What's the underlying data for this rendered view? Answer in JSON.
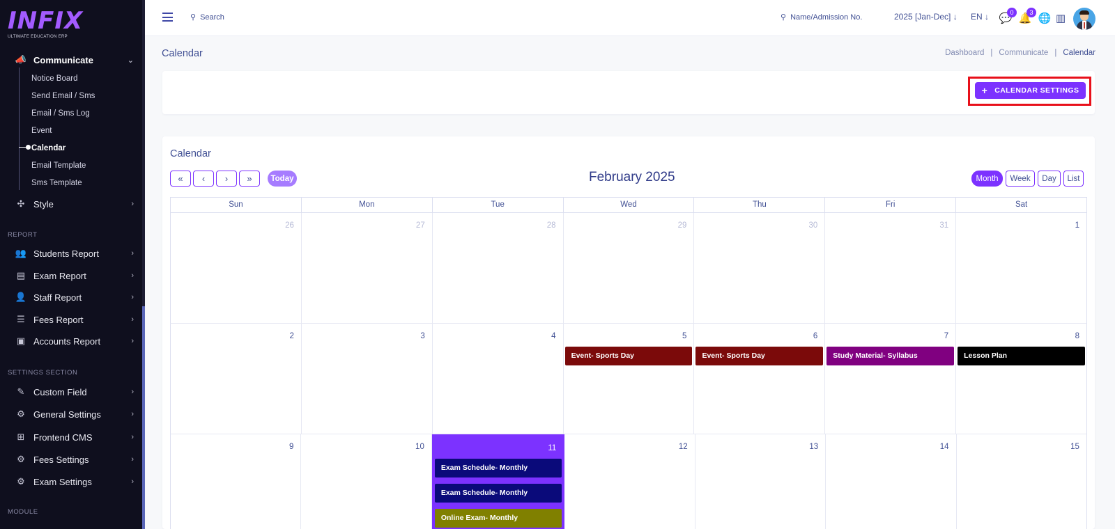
{
  "brand": {
    "logo_main": "INFIX",
    "logo_tagline": "ULTIMATE EDUCATION ERP"
  },
  "sidebar": {
    "communicate": {
      "label": "Communicate",
      "items": [
        "Notice Board",
        "Send Email / Sms",
        "Email / Sms Log",
        "Event",
        "Calendar",
        "Email Template",
        "Sms Template"
      ],
      "active": "Calendar"
    },
    "style_label": "Style",
    "report_section": "REPORT",
    "report_items": [
      "Students Report",
      "Exam Report",
      "Staff Report",
      "Fees Report",
      "Accounts Report"
    ],
    "settings_section": "SETTINGS SECTION",
    "settings_items": [
      "Custom Field",
      "General Settings",
      "Frontend CMS",
      "Fees Settings",
      "Exam Settings"
    ],
    "module_section": "MODULE"
  },
  "topbar": {
    "search_placeholder": "Search",
    "student_search_placeholder": "Name/Admission No.",
    "session": "2025 [Jan-Dec]",
    "language": "EN",
    "messages_count": "0",
    "notifications_count": "3"
  },
  "page": {
    "title": "Calendar",
    "breadcrumb": [
      "Dashboard",
      "Communicate",
      "Calendar"
    ],
    "settings_button": "CALENDAR SETTINGS"
  },
  "calendar": {
    "heading": "Calendar",
    "month_title": "February 2025",
    "nav": {
      "prev_year": "«",
      "prev": "‹",
      "next": "›",
      "next_year": "»"
    },
    "today_label": "Today",
    "views": [
      "Month",
      "Week",
      "Day",
      "List"
    ],
    "active_view": "Month",
    "weekdays": [
      "Sun",
      "Mon",
      "Tue",
      "Wed",
      "Thu",
      "Fri",
      "Sat"
    ],
    "weeks": [
      {
        "days": [
          "26",
          "27",
          "28",
          "29",
          "30",
          "31",
          "1"
        ],
        "other": [
          true,
          true,
          true,
          true,
          true,
          true,
          false
        ]
      },
      {
        "days": [
          "2",
          "3",
          "4",
          "5",
          "6",
          "7",
          "8"
        ],
        "other": [
          false,
          false,
          false,
          false,
          false,
          false,
          false
        ]
      },
      {
        "days": [
          "9",
          "10",
          "11",
          "12",
          "13",
          "14",
          "15"
        ],
        "other": [
          false,
          false,
          false,
          false,
          false,
          false,
          false
        ]
      }
    ],
    "today_day": "11",
    "events": [
      {
        "week": 1,
        "day": 3,
        "label": "Event- Sports Day",
        "color": "#7b0a0a"
      },
      {
        "week": 1,
        "day": 4,
        "label": "Event- Sports Day",
        "color": "#7b0a0a"
      },
      {
        "week": 1,
        "day": 5,
        "label": "Study Material- Syllabus",
        "color": "#800080"
      },
      {
        "week": 1,
        "day": 6,
        "label": "Lesson Plan",
        "color": "#000000"
      },
      {
        "week": 2,
        "day": 2,
        "label": "Exam Schedule- Monthly",
        "color": "#0a0a7a"
      },
      {
        "week": 2,
        "day": 2,
        "label": "Exam Schedule- Monthly",
        "color": "#0a0a7a"
      },
      {
        "week": 2,
        "day": 2,
        "label": "Online Exam- Monthly",
        "color": "#808000"
      }
    ]
  },
  "colors": {
    "accent": "#7c32ff",
    "sidebar_bg": "#0f0f1e",
    "highlight_border": "#e8101a"
  }
}
